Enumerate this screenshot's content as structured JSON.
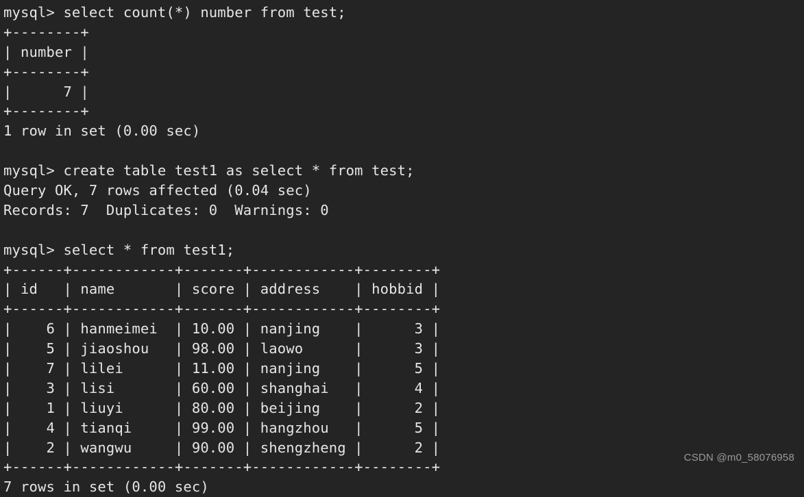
{
  "terminal": {
    "background_color": "#242424",
    "text_color": "#e6e6e6",
    "prompt": "mysql>",
    "lines": [
      "mysql> select count(*) number from test;",
      "+--------+",
      "| number |",
      "+--------+",
      "|      7 |",
      "+--------+",
      "1 row in set (0.00 sec)",
      "",
      "mysql> create table test1 as select * from test;",
      "Query OK, 7 rows affected (0.04 sec)",
      "Records: 7  Duplicates: 0  Warnings: 0",
      "",
      "mysql> select * from test1;",
      "+------+------------+-------+------------+--------+",
      "| id   | name       | score | address    | hobbid |",
      "+------+------------+-------+------------+--------+",
      "|    6 | hanmeimei  | 10.00 | nanjing    |      3 |",
      "|    5 | jiaoshou   | 98.00 | laowo      |      3 |",
      "|    7 | lilei      | 11.00 | nanjing    |      5 |",
      "|    3 | lisi       | 60.00 | shanghai   |      4 |",
      "|    1 | liuyi      | 80.00 | beijing    |      2 |",
      "|    4 | tianqi     | 99.00 | hangzhou   |      5 |",
      "|    2 | wangwu     | 90.00 | shengzheng |      2 |",
      "+------+------------+-------+------------+--------+",
      "7 rows in set (0.00 sec)"
    ],
    "commands": [
      "select count(*) number from test;",
      "create table test1 as select * from test;",
      "select * from test1;"
    ],
    "status_messages": [
      "1 row in set (0.00 sec)",
      "Query OK, 7 rows affected (0.04 sec)",
      "Records: 7  Duplicates: 0  Warnings: 0",
      "7 rows in set (0.00 sec)"
    ]
  },
  "result_count_table": {
    "columns": [
      "number"
    ],
    "rows": [
      [
        "7"
      ]
    ],
    "footer": "1 row in set (0.00 sec)"
  },
  "result_test1_table": {
    "columns": [
      "id",
      "name",
      "score",
      "address",
      "hobbid"
    ],
    "rows": [
      [
        "6",
        "hanmeimei",
        "10.00",
        "nanjing",
        "3"
      ],
      [
        "5",
        "jiaoshou",
        "98.00",
        "laowo",
        "3"
      ],
      [
        "7",
        "lilei",
        "11.00",
        "nanjing",
        "5"
      ],
      [
        "3",
        "lisi",
        "60.00",
        "shanghai",
        "4"
      ],
      [
        "1",
        "liuyi",
        "80.00",
        "beijing",
        "2"
      ],
      [
        "4",
        "tianqi",
        "99.00",
        "hangzhou",
        "5"
      ],
      [
        "2",
        "wangwu",
        "90.00",
        "shengzheng",
        "2"
      ]
    ],
    "footer": "7 rows in set (0.00 sec)"
  },
  "watermark": {
    "text": "CSDN @m0_58076958",
    "color": "#9a9a9a"
  }
}
